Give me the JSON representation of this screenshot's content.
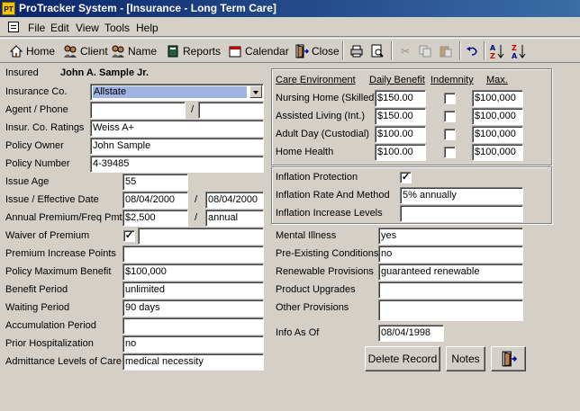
{
  "window": {
    "app_icon": "PT",
    "title": "ProTracker System - [Insurance - Long Term Care]"
  },
  "menu": [
    "File",
    "Edit",
    "View",
    "Tools",
    "Help"
  ],
  "toolbar": {
    "home": "Home",
    "client": "Client",
    "name": "Name",
    "reports": "Reports",
    "calendar": "Calendar",
    "close": "Close"
  },
  "insured": {
    "label": "Insured",
    "value": "John A. Sample Jr."
  },
  "left_fields": [
    {
      "label": "Insurance Co.",
      "value": "Allstate"
    },
    {
      "label": "Agent / Phone",
      "value": "",
      "value2": "",
      "sep": "/"
    },
    {
      "label": "Insur. Co. Ratings",
      "value": "Weiss A+"
    },
    {
      "label": "Policy Owner",
      "value": "John Sample"
    },
    {
      "label": "Policy Number",
      "value": "4-39485"
    },
    {
      "label": "Issue Age",
      "value": "55"
    },
    {
      "label": "Issue / Effective Date",
      "value": "08/04/2000",
      "value2": "08/04/2000",
      "sep": "/"
    },
    {
      "label": "Annual Premium/Freq Pmt",
      "value": "$2,500",
      "value2": "annual",
      "sep": "/"
    },
    {
      "label": "Waiver of Premium",
      "checked": true,
      "value": ""
    },
    {
      "label": "Premium Increase Points",
      "value": ""
    },
    {
      "label": "Policy Maximum Benefit",
      "value": "$100,000"
    },
    {
      "label": "Benefit Period",
      "value": "unlimited"
    },
    {
      "label": "Waiting Period",
      "value": "90 days"
    },
    {
      "label": "Accumulation Period",
      "value": ""
    },
    {
      "label": "Prior Hospitalization",
      "value": "no"
    },
    {
      "label": "Admittance Levels of Care",
      "value": "medical necessity"
    }
  ],
  "care": {
    "headers": {
      "env": "Care Environment",
      "daily": "Daily Benefit",
      "indemnity": "Indemnity",
      "max": "Max."
    },
    "rows": [
      {
        "env": "Nursing Home (Skilled)",
        "daily": "$150.00",
        "indemnity": false,
        "max": "$100,000"
      },
      {
        "env": "Assisted Living (Int.)",
        "daily": "$150.00",
        "indemnity": false,
        "max": "$100,000"
      },
      {
        "env": "Adult Day (Custodial)",
        "daily": "$100.00",
        "indemnity": false,
        "max": "$100,000"
      },
      {
        "env": "Home Health",
        "daily": "$100.00",
        "indemnity": false,
        "max": "$100,000"
      }
    ]
  },
  "inflation": {
    "protection_label": "Inflation Protection",
    "protection_checked": true,
    "rate_label": "Inflation Rate And Method",
    "rate_value": "5% annually",
    "levels_label": "Inflation Increase Levels",
    "levels_value": ""
  },
  "right_fields": [
    {
      "label": "Mental Illness",
      "value": "yes"
    },
    {
      "label": "Pre-Existing Conditions",
      "value": "no"
    },
    {
      "label": "Renewable Provisions",
      "value": "guaranteed renewable"
    },
    {
      "label": "Product Upgrades",
      "value": ""
    },
    {
      "label": "Other Provisions",
      "value": ""
    },
    {
      "label": "Info As Of",
      "value": "08/04/1998"
    }
  ],
  "buttons": {
    "delete": "Delete Record",
    "notes": "Notes"
  },
  "colors": {
    "title_start": "#0a246a",
    "title_end": "#3a6ea5",
    "face": "#d4d0c8",
    "selection": "#9fb4e2"
  }
}
